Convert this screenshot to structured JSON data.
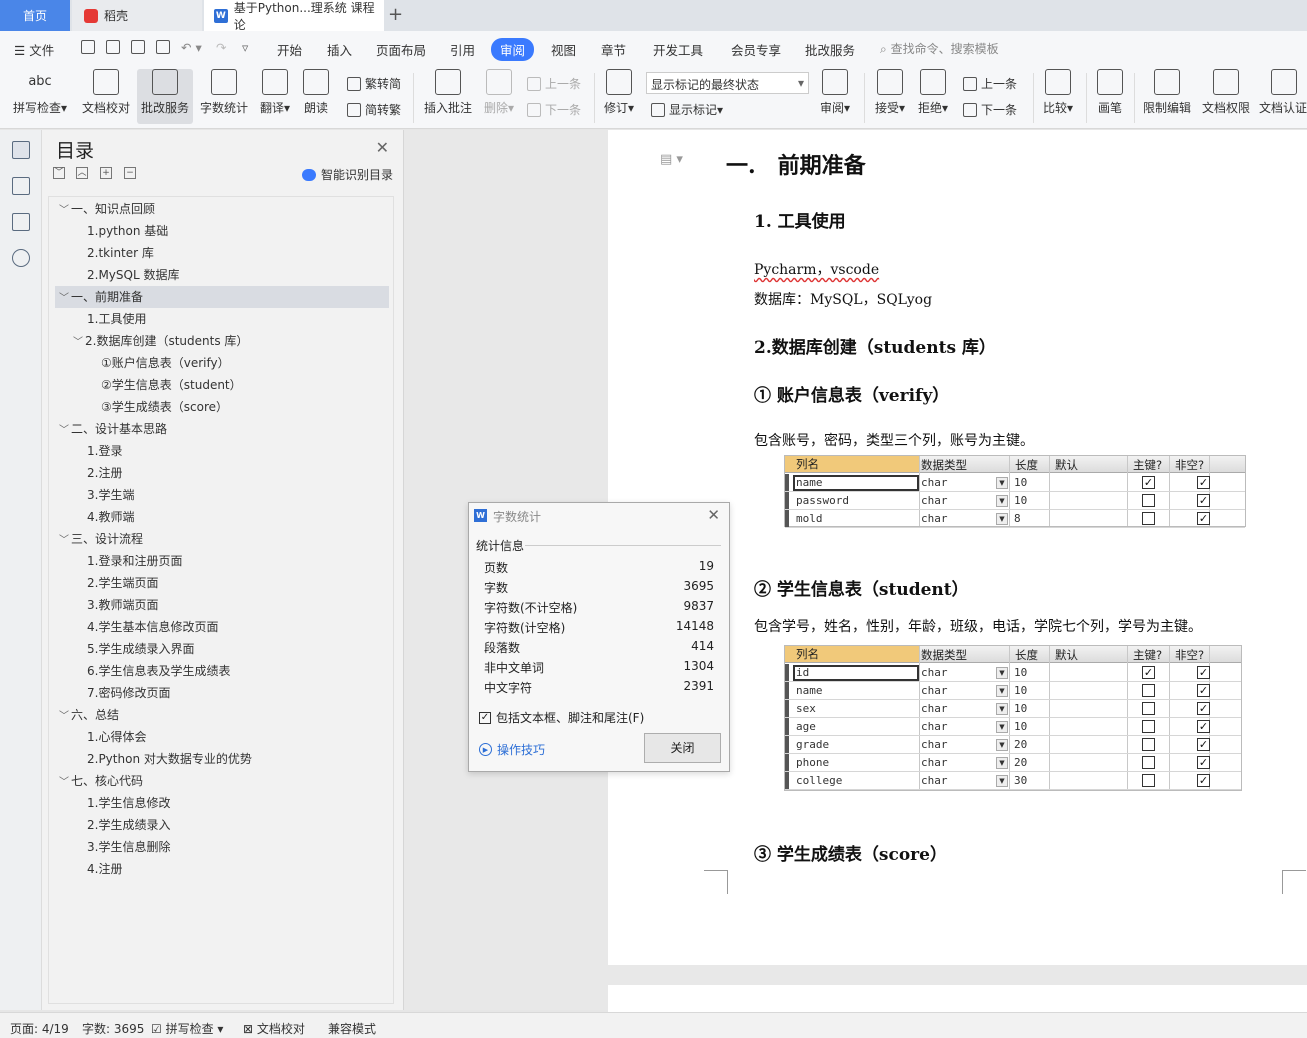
{
  "tabs": {
    "home": "首页",
    "daoke": "稻壳",
    "doc": "基于Python...理系统 课程论"
  },
  "menu": {
    "file": "文件",
    "items": [
      "开始",
      "插入",
      "页面布局",
      "引用",
      "审阅",
      "视图",
      "章节",
      "开发工具",
      "会员专享",
      "批改服务"
    ],
    "active_index": 4,
    "search_placeholder": "查找命令、搜索模板"
  },
  "ribbon": {
    "spell": "拼写检查",
    "spell_top": "abc",
    "doc_check": "文档校对",
    "correct_service": "批改服务",
    "word_count": "字数统计",
    "translate": "翻译",
    "read_aloud": "朗读",
    "to_trad": "繁转简",
    "to_simp": "简转繁",
    "insert_comment": "插入批注",
    "delete": "删除",
    "prev": "上一条",
    "next": "下一条",
    "revise": "修订",
    "markup_state": "显示标记的最终状态",
    "show_markup": "显示标记",
    "review": "审阅",
    "accept": "接受",
    "reject": "拒绝",
    "prev2": "上一条",
    "next2": "下一条",
    "compare": "比较",
    "pen": "画笔",
    "restrict": "限制编辑",
    "doc_perm": "文档权限",
    "doc_auth": "文档认证"
  },
  "toc": {
    "title": "目录",
    "smart": "智能识别目录",
    "items": [
      {
        "text": "一、知识点回顾",
        "level": 1,
        "caret": "﹀"
      },
      {
        "text": "1.python 基础",
        "level": 2
      },
      {
        "text": "2.tkinter 库",
        "level": 2
      },
      {
        "text": "2.MySQL 数据库",
        "level": 2
      },
      {
        "text": "一、前期准备",
        "level": 1,
        "caret": "﹀",
        "highlight": true
      },
      {
        "text": "1.工具使用",
        "level": 2
      },
      {
        "text": "2.数据库创建（students 库）",
        "level": 2,
        "caret": "﹀"
      },
      {
        "text": "①账户信息表（verify）",
        "level": 3
      },
      {
        "text": "②学生信息表（student）",
        "level": 3
      },
      {
        "text": "③学生成绩表（score）",
        "level": 3
      },
      {
        "text": "二、设计基本思路",
        "level": 1,
        "caret": "﹀"
      },
      {
        "text": "1.登录",
        "level": 2
      },
      {
        "text": "2.注册",
        "level": 2
      },
      {
        "text": "3.学生端",
        "level": 2
      },
      {
        "text": "4.教师端",
        "level": 2
      },
      {
        "text": "三、设计流程",
        "level": 1,
        "caret": "﹀"
      },
      {
        "text": "1.登录和注册页面",
        "level": 2
      },
      {
        "text": "2.学生端页面",
        "level": 2
      },
      {
        "text": "3.教师端页面",
        "level": 2
      },
      {
        "text": "4.学生基本信息修改页面",
        "level": 2
      },
      {
        "text": "5.学生成绩录入界面",
        "level": 2
      },
      {
        "text": "6.学生信息表及学生成绩表",
        "level": 2
      },
      {
        "text": "7.密码修改页面",
        "level": 2
      },
      {
        "text": "六、总结",
        "level": 1,
        "caret": "﹀"
      },
      {
        "text": "1.心得体会",
        "level": 2
      },
      {
        "text": "2.Python 对大数据专业的优势",
        "level": 2
      },
      {
        "text": "七、核心代码",
        "level": 1,
        "caret": "﹀"
      },
      {
        "text": "1.学生信息修改",
        "level": 2
      },
      {
        "text": "2.学生成绩录入",
        "level": 2
      },
      {
        "text": "3.学生信息删除",
        "level": 2
      },
      {
        "text": "4.注册",
        "level": 2
      }
    ]
  },
  "doc": {
    "h1": "一.　前期准备",
    "h2_tools": "1. 工具使用",
    "tools_line1": "Pycharm，vscode",
    "tools_line2": "数据库：MySQL，SQLyog",
    "h2_db": "2.数据库创建（students 库）",
    "h3_verify": "① 账户信息表（verify）",
    "verify_desc": "包含账号，密码，类型三个列，账号为主键。",
    "h3_student": "② 学生信息表（student）",
    "student_desc": "包含学号，姓名，性别，年龄，班级，电话，学院七个列，学号为主键。",
    "h3_score": "③ 学生成绩表（score）",
    "table_headers": [
      "列名",
      "数据类型",
      "长度",
      "默认",
      "主键?",
      "非空?"
    ],
    "verify_rows": [
      {
        "name": "name",
        "type": "char",
        "len": "10",
        "pk": true,
        "nn": true
      },
      {
        "name": "password",
        "type": "char",
        "len": "10",
        "pk": false,
        "nn": true
      },
      {
        "name": "mold",
        "type": "char",
        "len": "8",
        "pk": false,
        "nn": true
      }
    ],
    "student_rows": [
      {
        "name": "id",
        "type": "char",
        "len": "10",
        "pk": true,
        "nn": true
      },
      {
        "name": "name",
        "type": "char",
        "len": "10",
        "pk": false,
        "nn": true
      },
      {
        "name": "sex",
        "type": "char",
        "len": "10",
        "pk": false,
        "nn": true
      },
      {
        "name": "age",
        "type": "char",
        "len": "10",
        "pk": false,
        "nn": true
      },
      {
        "name": "grade",
        "type": "char",
        "len": "20",
        "pk": false,
        "nn": true
      },
      {
        "name": "phone",
        "type": "char",
        "len": "20",
        "pk": false,
        "nn": true
      },
      {
        "name": "college",
        "type": "char",
        "len": "30",
        "pk": false,
        "nn": true
      }
    ]
  },
  "dialog": {
    "title": "字数统计",
    "section": "统计信息",
    "stats": [
      {
        "label": "页数",
        "value": "19"
      },
      {
        "label": "字数",
        "value": "3695"
      },
      {
        "label": "字符数(不计空格)",
        "value": "9837"
      },
      {
        "label": "字符数(计空格)",
        "value": "14148"
      },
      {
        "label": "段落数",
        "value": "414"
      },
      {
        "label": "非中文单词",
        "value": "1304"
      },
      {
        "label": "中文字符",
        "value": "2391"
      }
    ],
    "include_label": "包括文本框、脚注和尾注(F)",
    "include_checked": true,
    "tips": "操作技巧",
    "close": "关闭"
  },
  "status": {
    "page": "页面: 4/19",
    "words": "字数: 3695",
    "spell": "拼写检查",
    "doc_check": "文档校对",
    "compat": "兼容模式"
  },
  "colors": {
    "accent": "#3a7afe",
    "home_tab": "#4a86e8",
    "header_orange": "#f1c97a"
  }
}
